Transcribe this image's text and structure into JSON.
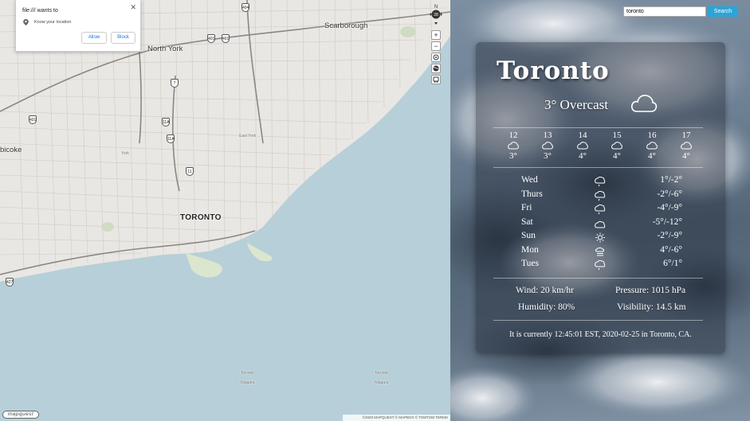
{
  "permission_popup": {
    "title": "file:/// wants to",
    "request": "Know your location",
    "allow_label": "Allow",
    "block_label": "Block",
    "close_glyph": "✕",
    "icons": [
      "location-pin-icon",
      "close-icon"
    ]
  },
  "map": {
    "labels": {
      "toronto": "TORONTO",
      "north_york": "North York",
      "scarborough": "Scarborough",
      "etobicoke": "bicoke",
      "york": "York",
      "east_york": "East York",
      "water1": "Toronto",
      "water1b": "Niagara",
      "water2": "Toronto",
      "water2b": "Niagara"
    },
    "highways": [
      "401",
      "401",
      "404",
      "401",
      "7",
      "11A",
      "11A",
      "11",
      "427"
    ],
    "controls": {
      "compass_n": "N",
      "compass_value": "28",
      "zoom_in": "+",
      "zoom_out": "−",
      "icons": [
        "compass-icon",
        "zoom-in-icon",
        "zoom-out-icon",
        "locate-icon",
        "globe-icon",
        "traffic-icon"
      ]
    },
    "logo": "mapquest",
    "attribution": "©2020 MAPQUEST  © MAPBOX  © TOMTOM  TERMS"
  },
  "search": {
    "value": "toronto",
    "button_label": "Search"
  },
  "weather": {
    "city": "Toronto",
    "current": "3° Overcast",
    "current_icon": "cloud-icon",
    "hourly": [
      {
        "hour": "12",
        "temp": "3°",
        "icon": "cloud-icon"
      },
      {
        "hour": "13",
        "temp": "3°",
        "icon": "cloud-icon"
      },
      {
        "hour": "14",
        "temp": "4°",
        "icon": "cloud-icon"
      },
      {
        "hour": "15",
        "temp": "4°",
        "icon": "cloud-icon"
      },
      {
        "hour": "16",
        "temp": "4°",
        "icon": "cloud-icon"
      },
      {
        "hour": "17",
        "temp": "4°",
        "icon": "cloud-icon"
      }
    ],
    "daily": [
      {
        "day": "Wed",
        "range": "1°/-2°",
        "icon": "rain-cloud-icon"
      },
      {
        "day": "Thurs",
        "range": "-2°/-6°",
        "icon": "rain-cloud-icon"
      },
      {
        "day": "Fri",
        "range": "-4°/-9°",
        "icon": "rain-cloud-icon"
      },
      {
        "day": "Sat",
        "range": "-5°/-12°",
        "icon": "cloud-icon"
      },
      {
        "day": "Sun",
        "range": "-2°/-9°",
        "icon": "sun-icon"
      },
      {
        "day": "Mon",
        "range": "4°/-6°",
        "icon": "fog-icon"
      },
      {
        "day": "Tues",
        "range": "6°/1°",
        "icon": "rain-cloud-icon"
      }
    ],
    "wind": "Wind: 20 km/hr",
    "pressure": "Pressure: 1015 hPa",
    "humidity": "Humidity: 80%",
    "visibility": "Visibility: 14.5 km",
    "footer": "It is currently 12:45:01 EST, 2020-02-25 in Toronto, CA."
  }
}
